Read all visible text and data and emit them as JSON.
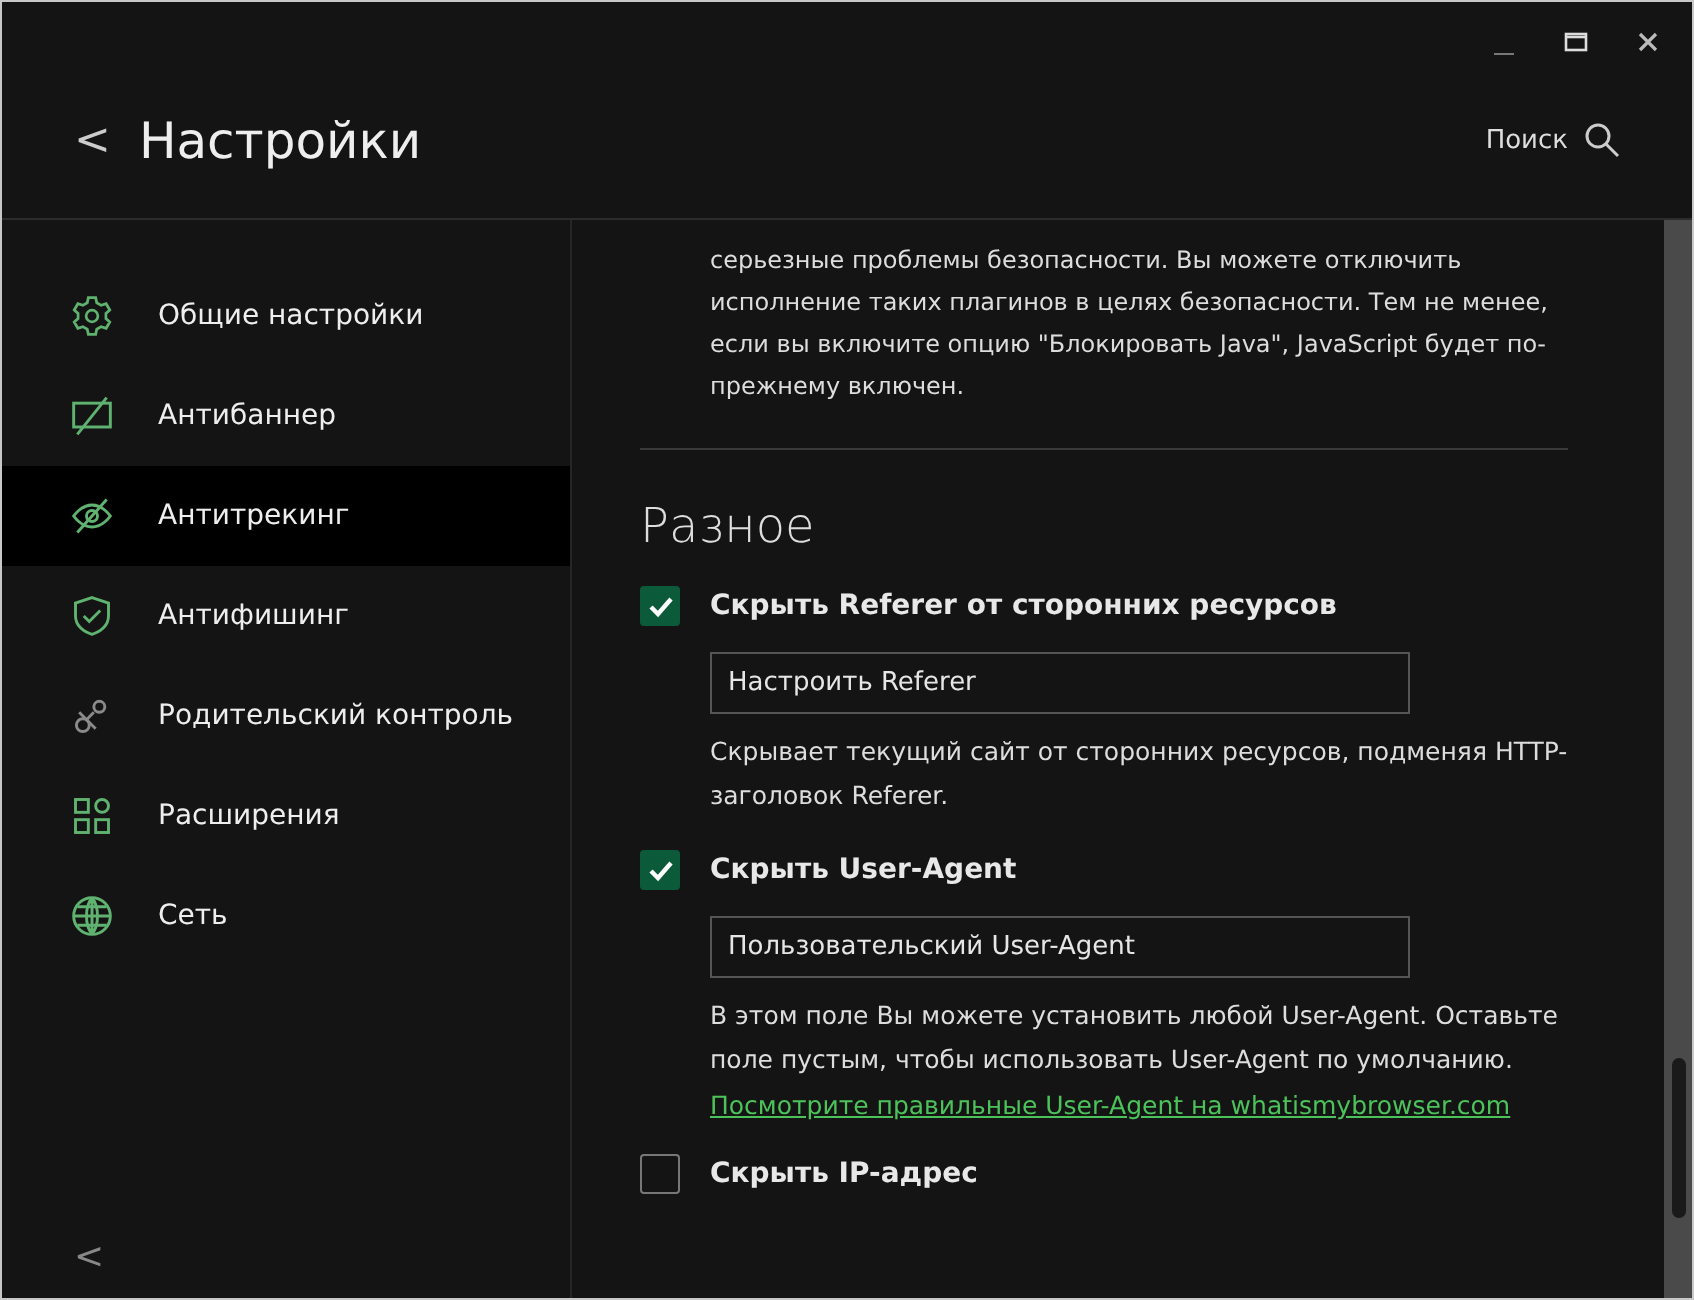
{
  "header": {
    "back": "<",
    "title": "Настройки",
    "search_label": "Поиск"
  },
  "sidebar": {
    "items": [
      {
        "label": "Общие настройки",
        "selected": false
      },
      {
        "label": "Антибаннер",
        "selected": false
      },
      {
        "label": "Антитрекинг",
        "selected": true
      },
      {
        "label": "Антифишинг",
        "selected": false
      },
      {
        "label": "Родительский контроль",
        "selected": false
      },
      {
        "label": "Расширения",
        "selected": false
      },
      {
        "label": "Сеть",
        "selected": false
      }
    ],
    "collapse": "<"
  },
  "content": {
    "intro": "серьезные проблемы безопасности. Вы можете отключить исполнение таких плагинов в целях безопасности. Тем не менее, если вы включите опцию \"Блокировать Java\", JavaScript будет по-прежнему включен.",
    "section_title": "Разное",
    "options": [
      {
        "label": "Скрыть Referer от сторонних ресурсов",
        "checked": true,
        "field": "Настроить Referer",
        "description": "Скрывает текущий сайт от сторонних ресурсов, подменяя HTTP-заголовок Referer."
      },
      {
        "label": "Скрыть User-Agent",
        "checked": true,
        "field": "Пользовательский User-Agent",
        "description": "В этом поле Вы можете установить любой User-Agent. Оставьте поле пустым, чтобы использовать User-Agent по умолчанию.",
        "link": "Посмотрите правильные User-Agent на whatismybrowser.com"
      },
      {
        "label": "Скрыть IP-адрес",
        "checked": false
      }
    ]
  }
}
